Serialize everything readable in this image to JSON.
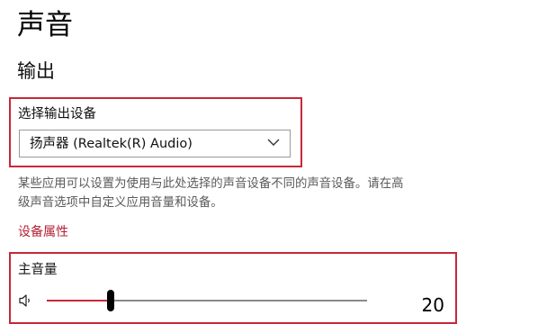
{
  "page": {
    "title": "声音"
  },
  "output": {
    "section_title": "输出",
    "device_label": "选择输出设备",
    "device_selected": "扬声器 (Realtek(R) Audio)",
    "description_lines": [
      "某些应用可以设置为使用与此处选择的声音设备不同的声音设备。请在高",
      "级声音选项中自定义应用音量和设备。"
    ],
    "properties_link": "设备属性",
    "volume_label": "主音量",
    "volume_value": "20",
    "volume_level": 0.2
  },
  "icons": {
    "dropdown": "chevron-down-icon",
    "volume": "speaker-icon"
  },
  "colors": {
    "accent": "#c8283a",
    "link": "#b52035",
    "highlight_border": "#c8283a"
  }
}
